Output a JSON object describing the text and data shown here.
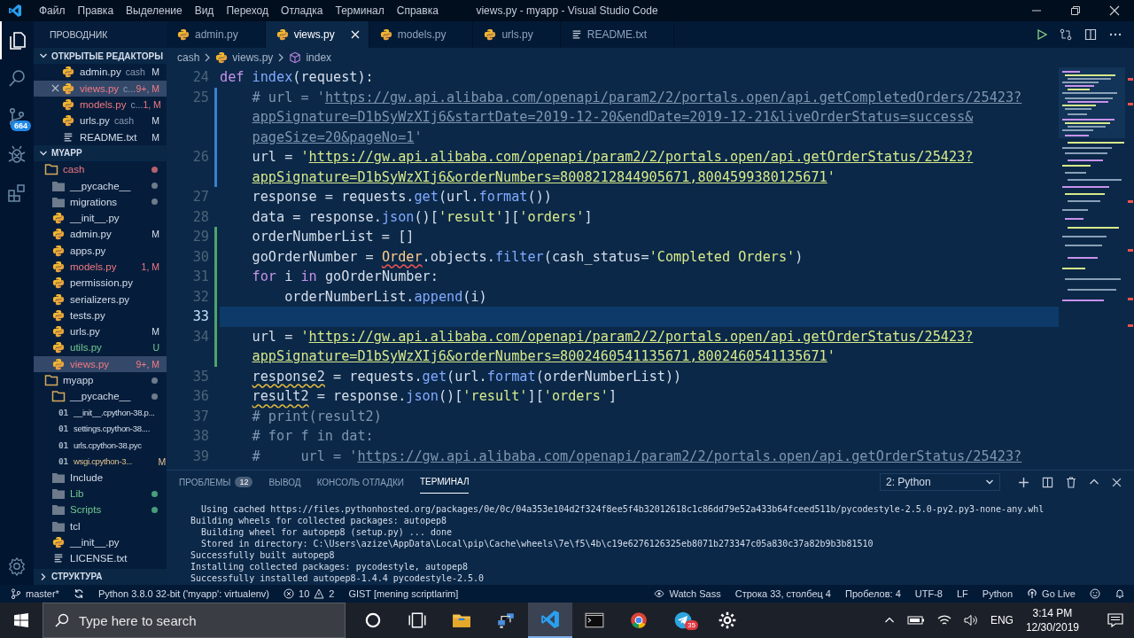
{
  "window": {
    "title": "views.py - myapp - Visual Studio Code"
  },
  "menu": [
    "Файл",
    "Правка",
    "Выделение",
    "Вид",
    "Переход",
    "Отладка",
    "Терминал",
    "Справка"
  ],
  "activity_bar": [
    {
      "kind": "explorer",
      "selected": true
    },
    {
      "kind": "search",
      "selected": false
    },
    {
      "kind": "source-control",
      "selected": false,
      "badge": "664"
    },
    {
      "kind": "debug",
      "selected": false
    },
    {
      "kind": "extensions",
      "selected": false
    }
  ],
  "sidebar": {
    "title": "ПРОВОДНИК",
    "open_editors": {
      "title": "ОТКРЫТЫЕ РЕДАКТОРЫ",
      "expanded": true,
      "items": [
        {
          "kind": "python",
          "name": "admin.py",
          "description": "cash",
          "badge": "M",
          "error": false,
          "selected": false
        },
        {
          "kind": "python",
          "name": "views.py",
          "description": "c...",
          "badge": "9+, M",
          "error": true,
          "selected": true
        },
        {
          "kind": "python",
          "name": "models.py",
          "description": "c...",
          "badge": "1, M",
          "error": true,
          "selected": false
        },
        {
          "kind": "python",
          "name": "urls.py",
          "description": "cash",
          "badge": "M",
          "error": false,
          "selected": false
        },
        {
          "kind": "text",
          "name": "README.txt",
          "badge": "M",
          "error": false,
          "selected": false
        }
      ]
    },
    "project": {
      "title": "MYAPP",
      "expanded": true,
      "tree": [
        {
          "kind": "folder",
          "name": "cash",
          "error": true,
          "untracked": false,
          "modified": false,
          "dot": true,
          "expanded": true,
          "selected": false,
          "children": [
            {
              "kind": "folder",
              "name": "__pycache__",
              "error": false,
              "untracked": false,
              "modified": false,
              "dot": true,
              "expanded": false,
              "selected": false
            },
            {
              "kind": "folder",
              "name": "migrations",
              "error": false,
              "untracked": false,
              "modified": false,
              "dot": true,
              "expanded": false,
              "selected": false
            },
            {
              "kind": "python",
              "name": "__init__.py",
              "error": false,
              "untracked": false,
              "modified": false,
              "selected": false
            },
            {
              "kind": "python",
              "name": "admin.py",
              "badge": "M",
              "error": false,
              "untracked": false,
              "modified": false,
              "selected": false
            },
            {
              "kind": "python",
              "name": "apps.py",
              "error": false,
              "untracked": false,
              "modified": false,
              "selected": false
            },
            {
              "kind": "python",
              "name": "models.py",
              "badge": "1, M",
              "error": true,
              "untracked": false,
              "modified": false,
              "selected": false
            },
            {
              "kind": "python",
              "name": "permission.py",
              "error": false,
              "untracked": false,
              "modified": false,
              "selected": false
            },
            {
              "kind": "python",
              "name": "serializers.py",
              "error": false,
              "untracked": false,
              "modified": false,
              "selected": false
            },
            {
              "kind": "python",
              "name": "tests.py",
              "error": false,
              "untracked": false,
              "modified": false,
              "selected": false
            },
            {
              "kind": "python",
              "name": "urls.py",
              "badge": "M",
              "error": false,
              "untracked": false,
              "modified": false,
              "selected": false
            },
            {
              "kind": "python",
              "name": "utils.py",
              "badge": "U",
              "error": false,
              "untracked": true,
              "modified": false,
              "selected": false
            },
            {
              "kind": "python",
              "name": "views.py",
              "badge": "9+, M",
              "error": true,
              "untracked": false,
              "modified": false,
              "selected": true
            }
          ]
        },
        {
          "kind": "folder",
          "name": "myapp",
          "error": false,
          "untracked": false,
          "modified": false,
          "dot": true,
          "expanded": true,
          "selected": false,
          "children": [
            {
              "kind": "folder",
              "name": "__pycache__",
              "error": false,
              "untracked": false,
              "modified": false,
              "dot": true,
              "expanded": true,
              "selected": false,
              "children": [
                {
                  "kind": "binary",
                  "icon_text": "01",
                  "name": "__init__.cpython-38.p...",
                  "error": false,
                  "untracked": false,
                  "modified": false,
                  "selected": false
                },
                {
                  "kind": "binary",
                  "icon_text": "01",
                  "name": "settings.cpython-38....",
                  "error": false,
                  "untracked": false,
                  "modified": false,
                  "selected": false
                },
                {
                  "kind": "binary",
                  "icon_text": "01",
                  "name": "urls.cpython-38.pyc",
                  "error": false,
                  "untracked": false,
                  "modified": false,
                  "selected": false
                },
                {
                  "kind": "binary",
                  "icon_text": "01",
                  "name": "wsgi.cpython-3...",
                  "badge": "M",
                  "error": false,
                  "untracked": false,
                  "modified": true,
                  "selected": false
                }
              ]
            },
            {
              "kind": "folder",
              "name": "Include",
              "error": false,
              "untracked": false,
              "modified": false,
              "dot": false,
              "expanded": false,
              "selected": false
            },
            {
              "kind": "folder",
              "name": "Lib",
              "error": false,
              "untracked": true,
              "modified": false,
              "dot": true,
              "expanded": false,
              "selected": false
            },
            {
              "kind": "folder",
              "name": "Scripts",
              "error": false,
              "untracked": true,
              "modified": false,
              "dot": true,
              "expanded": false,
              "selected": false
            },
            {
              "kind": "folder",
              "name": "tcl",
              "error": false,
              "untracked": false,
              "modified": false,
              "dot": false,
              "expanded": false,
              "selected": false
            },
            {
              "kind": "python",
              "name": "__init__.py",
              "error": false,
              "untracked": false,
              "modified": false,
              "selected": false
            },
            {
              "kind": "text",
              "name": "LICENSE.txt",
              "error": false,
              "untracked": false,
              "modified": false,
              "selected": false
            }
          ]
        }
      ]
    },
    "outline": {
      "title": "СТРУКТУРА",
      "expanded": false
    }
  },
  "tabs": [
    {
      "kind": "python",
      "label": "admin.py",
      "selected": false
    },
    {
      "kind": "python",
      "label": "views.py",
      "selected": true
    },
    {
      "kind": "python",
      "label": "models.py",
      "selected": false
    },
    {
      "kind": "python",
      "label": "urls.py",
      "selected": false
    },
    {
      "kind": "text",
      "label": "README.txt",
      "selected": false
    }
  ],
  "breadcrumbs": [
    {
      "kind": "folder",
      "label": "cash"
    },
    {
      "kind": "python",
      "label": "views.py"
    },
    {
      "kind": "symbol",
      "label": "index"
    }
  ],
  "code": {
    "lines": [
      {
        "number": "24",
        "current": false,
        "added": false,
        "modified": false,
        "segments": [
          {
            "tokens": [
              {
                "kind": "keyword",
                "text": "def"
              },
              {
                "kind": "function",
                "text": " index"
              },
              {
                "kind": "plain",
                "text": "(request):"
              }
            ]
          }
        ]
      },
      {
        "number": "25",
        "current": false,
        "added": false,
        "modified": true,
        "segments": [
          {
            "tokens": [
              {
                "kind": "comment",
                "text": "    # url = '"
              },
              {
                "kind": "comment-link",
                "text": "https://gw.api.alibaba.com/openapi/param2/2/portals.open/api.getCompletedOrders/25423?"
              }
            ]
          },
          {
            "tokens": [
              {
                "kind": "comment-link",
                "text": "appSignature=D1bSyWzXIj6&startDate=2019-12-20&endDate=2019-12-21&liveOrderStatus=success&"
              }
            ]
          },
          {
            "tokens": [
              {
                "kind": "comment-link",
                "text": "pageSize=20&pageNo=1"
              },
              {
                "kind": "comment",
                "text": "'"
              }
            ]
          }
        ]
      },
      {
        "number": "26",
        "current": false,
        "added": false,
        "modified": true,
        "segments": [
          {
            "tokens": [
              {
                "kind": "plain",
                "text": "    url = "
              },
              {
                "kind": "string",
                "text": "'"
              },
              {
                "kind": "link",
                "text": "https://gw.api.alibaba.com/openapi/param2/2/portals.open/api.getOrderStatus/25423?"
              }
            ]
          },
          {
            "tokens": [
              {
                "kind": "link",
                "text": "appSignature=D1bSyWzXIj6&orderNumbers=8008212844905671,8004599380125671"
              },
              {
                "kind": "string",
                "text": "'"
              }
            ]
          }
        ]
      },
      {
        "number": "27",
        "current": false,
        "added": false,
        "modified": false,
        "segments": [
          {
            "tokens": [
              {
                "kind": "plain",
                "text": "    response = requests."
              },
              {
                "kind": "function",
                "text": "get"
              },
              {
                "kind": "plain",
                "text": "(url."
              },
              {
                "kind": "function",
                "text": "format"
              },
              {
                "kind": "plain",
                "text": "())"
              }
            ]
          }
        ]
      },
      {
        "number": "28",
        "current": false,
        "added": false,
        "modified": false,
        "segments": [
          {
            "tokens": [
              {
                "kind": "plain",
                "text": "    data = response."
              },
              {
                "kind": "function",
                "text": "json"
              },
              {
                "kind": "plain",
                "text": "()["
              },
              {
                "kind": "string",
                "text": "'result'"
              },
              {
                "kind": "plain",
                "text": "]["
              },
              {
                "kind": "string",
                "text": "'orders'"
              },
              {
                "kind": "plain",
                "text": "]"
              }
            ]
          }
        ]
      },
      {
        "number": "29",
        "current": false,
        "added": true,
        "modified": false,
        "segments": [
          {
            "tokens": [
              {
                "kind": "plain",
                "text": "    orderNumberList = []"
              }
            ]
          }
        ]
      },
      {
        "number": "30",
        "current": false,
        "added": true,
        "modified": false,
        "segments": [
          {
            "tokens": [
              {
                "kind": "plain",
                "text": "    goOrderNumber = "
              },
              {
                "kind": "class-error",
                "text": "Order"
              },
              {
                "kind": "plain",
                "text": ".objects."
              },
              {
                "kind": "function",
                "text": "filter"
              },
              {
                "kind": "plain",
                "text": "(cash_status="
              },
              {
                "kind": "string",
                "text": "'Completed Orders'"
              },
              {
                "kind": "plain",
                "text": ")"
              }
            ]
          }
        ]
      },
      {
        "number": "31",
        "current": false,
        "added": true,
        "modified": false,
        "segments": [
          {
            "tokens": [
              {
                "kind": "keyword",
                "text": "    for"
              },
              {
                "kind": "plain",
                "text": " i "
              },
              {
                "kind": "keyword",
                "text": "in"
              },
              {
                "kind": "plain",
                "text": " goOrderNumber:"
              }
            ]
          }
        ]
      },
      {
        "number": "32",
        "current": false,
        "added": true,
        "modified": false,
        "segments": [
          {
            "tokens": [
              {
                "kind": "plain",
                "text": "        orderNumberList."
              },
              {
                "kind": "function",
                "text": "append"
              },
              {
                "kind": "plain",
                "text": "(i)"
              }
            ]
          }
        ]
      },
      {
        "number": "33",
        "current": true,
        "added": true,
        "modified": false
      },
      {
        "number": "34",
        "current": false,
        "added": true,
        "modified": false,
        "segments": [
          {
            "tokens": [
              {
                "kind": "plain",
                "text": "    url = "
              },
              {
                "kind": "string",
                "text": "'"
              },
              {
                "kind": "link",
                "text": "https://gw.api.alibaba.com/openapi/param2/2/portals.open/api.getOrderStatus/25423?"
              }
            ]
          },
          {
            "tokens": [
              {
                "kind": "link",
                "text": "appSignature=D1bSyWzXIj6&orderNumbers=8002460541135671,8002460541135671"
              },
              {
                "kind": "string",
                "text": "'"
              }
            ]
          }
        ]
      },
      {
        "number": "35",
        "current": false,
        "added": false,
        "modified": false,
        "segments": [
          {
            "tokens": [
              {
                "kind": "plain-warning",
                "text": "    response2"
              },
              {
                "kind": "plain",
                "text": " = requests."
              },
              {
                "kind": "function",
                "text": "get"
              },
              {
                "kind": "plain",
                "text": "(url."
              },
              {
                "kind": "function",
                "text": "format"
              },
              {
                "kind": "plain",
                "text": "(orderNumberList))"
              }
            ]
          }
        ]
      },
      {
        "number": "36",
        "current": false,
        "added": false,
        "modified": false,
        "segments": [
          {
            "tokens": [
              {
                "kind": "plain-warning",
                "text": "    result2"
              },
              {
                "kind": "plain",
                "text": " = response."
              },
              {
                "kind": "function",
                "text": "json"
              },
              {
                "kind": "plain",
                "text": "()["
              },
              {
                "kind": "string",
                "text": "'result'"
              },
              {
                "kind": "plain",
                "text": "]["
              },
              {
                "kind": "string",
                "text": "'orders'"
              },
              {
                "kind": "plain",
                "text": "]"
              }
            ]
          }
        ]
      },
      {
        "number": "37",
        "current": false,
        "added": false,
        "modified": false,
        "segments": [
          {
            "tokens": [
              {
                "kind": "comment",
                "text": "    # print(result2)"
              }
            ]
          }
        ]
      },
      {
        "number": "38",
        "current": false,
        "added": false,
        "modified": false,
        "segments": [
          {
            "tokens": [
              {
                "kind": "comment",
                "text": "    # for f in dat:"
              }
            ]
          }
        ]
      },
      {
        "number": "39",
        "current": false,
        "added": false,
        "modified": false,
        "segments": [
          {
            "tokens": [
              {
                "kind": "comment",
                "text": "    #     url = '"
              },
              {
                "kind": "comment-link",
                "text": "https://gw.api.alibaba.com/openapi/param2/2/portals.open/api.getOrderStatus/25423?"
              }
            ]
          }
        ]
      }
    ]
  },
  "panel": {
    "tabs": [
      {
        "label": "ПРОБЛЕМЫ",
        "badge": "12",
        "selected": false
      },
      {
        "label": "ВЫВОД",
        "selected": false
      },
      {
        "label": "КОНСОЛЬ ОТЛАДКИ",
        "selected": false
      },
      {
        "label": "ТЕРМИНАЛ",
        "selected": true
      }
    ],
    "terminal_select": "2: Python",
    "terminal_lines": [
      "  Using cached https://files.pythonhosted.org/packages/0e/0c/04a353e104d2f324f8ee5f4b32012618c1c86dd79e52a433b64fceed511b/pycodestyle-2.5.0-py2.py3-none-any.whl",
      "Building wheels for collected packages: autopep8",
      "  Building wheel for autopep8 (setup.py) ... done",
      "  Stored in directory: C:\\Users\\azize\\AppData\\Local\\pip\\Cache\\wheels\\7e\\f5\\4b\\c19e6276126325eb8071b273347c05a830c37a82b9b3b81510",
      "Successfully built autopep8",
      "Installing collected packages: pycodestyle, autopep8",
      "Successfully installed autopep8-1.4.4 pycodestyle-2.5.0"
    ]
  },
  "status_bar": {
    "left": [
      {
        "kind": "branch",
        "text": "master*"
      },
      {
        "kind": "sync"
      },
      {
        "kind": "plain",
        "text": "Python 3.8.0 32-bit ('myapp': virtualenv)"
      },
      {
        "kind": "problems",
        "errors": "10",
        "warnings": "2"
      },
      {
        "kind": "plain",
        "text": "GIST [mening scriptlarim]"
      }
    ],
    "right": [
      {
        "kind": "watch",
        "text": "Watch Sass"
      },
      {
        "kind": "plain",
        "text": "Строка 33, столбец 4"
      },
      {
        "kind": "plain",
        "text": "Пробелов: 4"
      },
      {
        "kind": "plain",
        "text": "UTF-8"
      },
      {
        "kind": "plain",
        "text": "LF"
      },
      {
        "kind": "plain",
        "text": "Python"
      },
      {
        "kind": "live",
        "text": "Go Live"
      },
      {
        "kind": "feedback"
      },
      {
        "kind": "bell"
      }
    ]
  },
  "taskbar": {
    "search": {
      "placeholder": "Type here to search"
    },
    "apps": [
      {
        "kind": "cortana",
        "selected": false
      },
      {
        "kind": "task-view",
        "selected": false
      },
      {
        "kind": "files",
        "selected": false
      },
      {
        "kind": "network",
        "selected": false
      },
      {
        "kind": "vscode",
        "selected": true
      },
      {
        "kind": "terminal",
        "selected": false
      },
      {
        "kind": "browser",
        "selected": false
      },
      {
        "kind": "messenger",
        "selected": false,
        "badge": "35"
      },
      {
        "kind": "settings",
        "selected": false
      }
    ],
    "tray": {
      "language": "ENG",
      "time": "3:14 PM",
      "date": "12/30/2019"
    }
  }
}
